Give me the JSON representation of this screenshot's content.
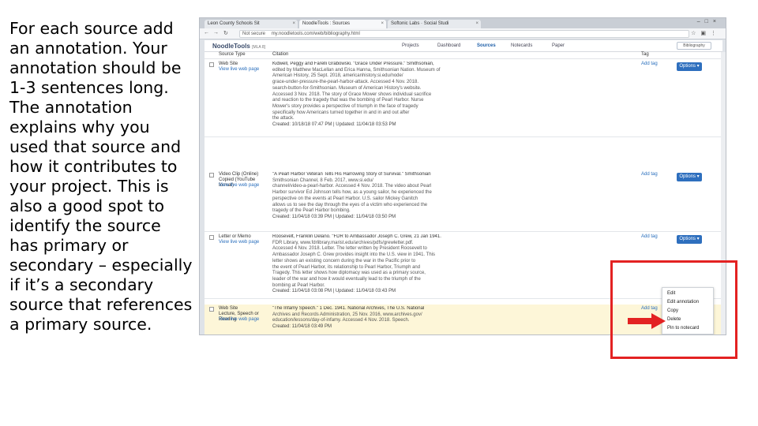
{
  "instruction_text": "For each source add an annotation. Your annotation should be 1-3 sentences long. The annotation explains why you used that source and how it contributes to your project. This is also a good spot to identify the source has primary or secondary – especially if it’s a secondary source that references a primary source.",
  "browser": {
    "tabs": [
      "Leon County Schools Sit",
      "NoodleTools : Sources",
      "Softonic Labs · Social Studi"
    ],
    "url_security": "Not secure",
    "url": "my.noodletools.com/web/bibliography.html"
  },
  "app": {
    "logo": "NoodleTools",
    "logo_style": "[MLA 8]",
    "nav": [
      "Projects",
      "Dashboard",
      "Sources",
      "Notecards",
      "Paper"
    ],
    "active_nav": "Sources",
    "dropdown_label": "Bibliography"
  },
  "columns": {
    "source_type": "Source Type",
    "citation": "Citation",
    "tag": "Tag"
  },
  "rows": [
    {
      "type": "Web Site",
      "type_sub": "",
      "link": "View live web page",
      "citation": [
        "Kidwell, Peggy and Farelli Grabowski. \"Grace Under Pressure.\" Smithsonian,",
        "edited by Matthew MacLellan and Erica Hanna, Smithsonian Nation. Museum of",
        "American History, 25 Sept. 2018, americanhistory.si.edu/node/",
        "grace-under-pressure-the-pearl-harbor-attack. Accessed 4 Nov. 2018.",
        "search-button-for-Smithsonian. Museum of American History's website.",
        "Accessed 3 Nov. 2018. The story of Grace Mower shows individual sacrifice",
        "and reaction to the tragedy that was the bombing of Pearl Harbor. Nurse",
        "Mower's story provides a perspective of triumph in the face of tragedy",
        "specifically how Americans turned together in and in and out after",
        "the attack."
      ],
      "created": "Created: 10/18/18 07:47 PM | Updated: 11/04/18 03:53 PM",
      "tag": "Add tag",
      "options": "Options"
    },
    {
      "type": "Video Clip (Online)",
      "type_sub": "Copied (YouTube format)",
      "link": "View live web page",
      "citation": [
        "\"A Pearl Harbor Veteran Tells His Harrowing Story of Survival.\" Smithsonian",
        "Smithsonian Channel, 8 Feb. 2017, www.si.edu/",
        "channel/video-a-pearl-harbor. Accessed 4 Nov. 2018. The video about Pearl",
        "Harbor survivor Ed Johnson tells how, as a young sailor, he experienced the",
        "perspective on the events at Pearl Harbor. U.S. sailor Mickey Ganitch",
        "allows us to see the day through the eyes of a victim who experienced the",
        "tragedy of the Pearl Harbor bombing."
      ],
      "created": "Created: 11/04/18 03:39 PM | Updated: 11/04/18 03:50 PM",
      "tag": "Add tag",
      "options": "Options"
    },
    {
      "type": "Letter or Memo",
      "type_sub": "",
      "link": "View live web page",
      "citation": [
        "Roosevelt, Franklin Delano. \"FDR to Ambassador Joseph C. Grew, 21 Jan 1941.",
        "FDR Library, www.fdrlibrary.marist.edu/archives/pdfs/grewletter.pdf.",
        "Accessed 4 Nov. 2018. Letter. The letter written by President Roosevelt to",
        "Ambassador Joseph C. Grew provides insight into the U.S. view in 1941. This",
        "letter shows an existing concern during the war in the Pacific prior to",
        "the event of Pearl Harbor, its relationship to Pearl Harbor, Triumph and",
        "Tragedy. This letter shows how diplomacy was used as a primary source,",
        "leader of the war and how it would eventually lead to the triumph of the",
        "bombing at Pearl Harbor."
      ],
      "created": "Created: 11/04/18 03:08 PM | Updated: 11/04/18 03:43 PM",
      "tag": "Add tag",
      "options": "Options"
    },
    {
      "type": "Web Site",
      "type_sub": "Lecture, Speech or Reading",
      "link": "View live web page",
      "citation": [
        "\"The Infamy Speech.\" 1 Dec. 1941. National Archives, The U.S. National",
        "Archives and Records Administration, 25 Nov. 2016, www.archives.gov/",
        "education/lessons/day-of-infamy. Accessed 4 Nov. 2018. Speech."
      ],
      "created": "Created: 11/04/18 03:49 PM",
      "tag": "Add tag",
      "options": "Options"
    }
  ],
  "dropdown_menu": [
    "Edit",
    "Edit annotation",
    "Copy",
    "Delete",
    "Pin to notecard"
  ],
  "annotation_colors": {
    "highlight_box": "#e32222",
    "arrow": "#e32222",
    "options_button": "#2e6fbe"
  }
}
